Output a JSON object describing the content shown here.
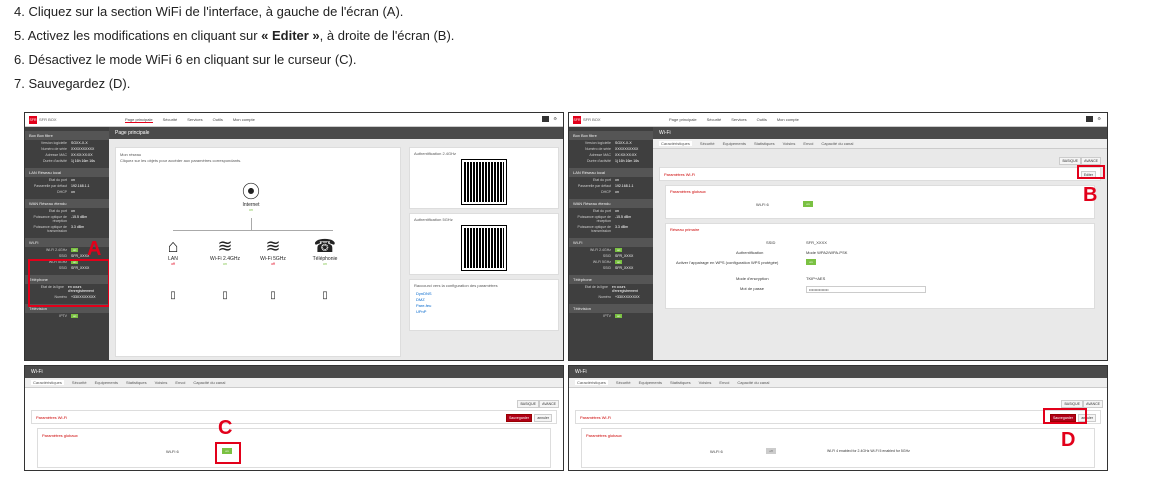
{
  "steps": [
    {
      "num": "4.",
      "text": "Cliquez sur la section WiFi de l'interface, à gauche de l'écran (A)."
    },
    {
      "num": "5.",
      "text_before": "Activez les modifications en cliquant sur ",
      "bold": "« Editer »",
      "text_after": ", à droite de l'écran (B)."
    },
    {
      "num": "6.",
      "text": "Désactivez le mode WiFi 6 en cliquant sur le curseur (C)."
    },
    {
      "num": "7.",
      "text": "Sauvegardez (D)."
    }
  ],
  "markers": {
    "a": "A",
    "b": "B",
    "c": "C",
    "d": "D"
  },
  "topbar": {
    "logo": "SFR",
    "logo_text": "SFR BOX",
    "nav": [
      "Page principale",
      "Sécurité",
      "Services",
      "Outils",
      "Mon compte"
    ]
  },
  "sidebar": {
    "box": "Box  Box fibre",
    "lan": "LAN  Réseau local",
    "wan": "WAN  Réseau étendu",
    "wifi": "Wi-Fi",
    "tel": "Téléphone",
    "tv": "Télévision",
    "box_rows": [
      [
        "Version logicielle",
        "SGXX-X-X"
      ],
      [
        "Numéro de série",
        "XXXXXXXXXX"
      ],
      [
        "Adresse MAC",
        "XX:XX:XX:XX"
      ],
      [
        "Durée d'activité",
        "1j 16h 16m 16s"
      ]
    ],
    "lan_rows": [
      [
        "Etat du port",
        "on"
      ],
      [
        "Passerelle par défaut",
        "192.168.1.1"
      ],
      [
        "DHCP",
        "on"
      ]
    ],
    "wan_rows": [
      [
        "Etat du port",
        "on"
      ],
      [
        "Puissance optique de réception",
        "-15.5 dBm"
      ],
      [
        "Puissance optique de transmission",
        "3.3 dBm"
      ]
    ],
    "wifi_rows": [
      [
        "Wi-Fi 2.4GHz",
        "on"
      ],
      [
        "SSID",
        "SFR_XXXX"
      ],
      [
        "Wi-Fi 5GHz",
        "on"
      ],
      [
        "SSID",
        "SFR_XXXX"
      ]
    ],
    "tel_rows": [
      [
        "Etat de la ligne",
        "en cours d'enregistrement"
      ],
      [
        "Numéro",
        "+33XXXXXXXX"
      ]
    ],
    "tv_rows": [
      [
        "IPTV",
        "on"
      ]
    ]
  },
  "home": {
    "title": "Page principale",
    "net_title": "Mon réseau",
    "net_desc": "Cliquez sur les objets pour accéder aux paramètres correspondants.",
    "internet": "Internet",
    "internet_state": "on",
    "devices": [
      {
        "label": "LAN",
        "state": "off",
        "icon": "house-icon"
      },
      {
        "label": "Wi-Fi 2.4GHz",
        "state": "on",
        "icon": "wifi-icon"
      },
      {
        "label": "Wi-Fi 5GHz",
        "state": "off",
        "icon": "wifi-icon"
      },
      {
        "label": "Téléphonie",
        "state": "on",
        "icon": "phone-icon"
      }
    ],
    "qr1": "Authentification 2.4GHz",
    "qr2": "Authentification 5GHz",
    "links_title": "Raccourci vers la configuration des paramètres",
    "links": [
      "DynDNS",
      "DMZ",
      "Pare-feu",
      "UPnP"
    ]
  },
  "wifi": {
    "title": "Wi-Fi",
    "tabs": [
      "Caractéristiques",
      "Sécurité",
      "Equipements",
      "Statistiques",
      "Voisins",
      "Envoi",
      "Capacité du canal"
    ],
    "basic": "BASIQUE",
    "advanced": "AVANCE",
    "params": "Paramètres Wi-Fi",
    "global": "Paramètres globaux",
    "wifi6": "Wi-Fi 6",
    "on": "on",
    "off": "off",
    "edit": "Editer",
    "save": "Sauvegarder",
    "cancel": "annuler",
    "primary": "Réseau primaire",
    "ssid_label": "SSID",
    "ssid": "SFR_XXXX",
    "auth_label": "Authentification",
    "auth": "Mode WPA2/WPA-PSK",
    "wps_label": "Activer l'appairage en WPS (configuration WPS protégée)",
    "enc_label": "Mode d'encryption",
    "enc": "TKIP+AES",
    "pwd_label": "Mot de passe",
    "pwd": "••••••••••••••",
    "info": "Wi-Fi 4 enabled for 2.4GHz Wi-Fi 5 enabled for 5GHz"
  },
  "colors": {
    "accent": "#e2001a",
    "ok": "#7ac142",
    "dark": "#4a4a4a"
  }
}
